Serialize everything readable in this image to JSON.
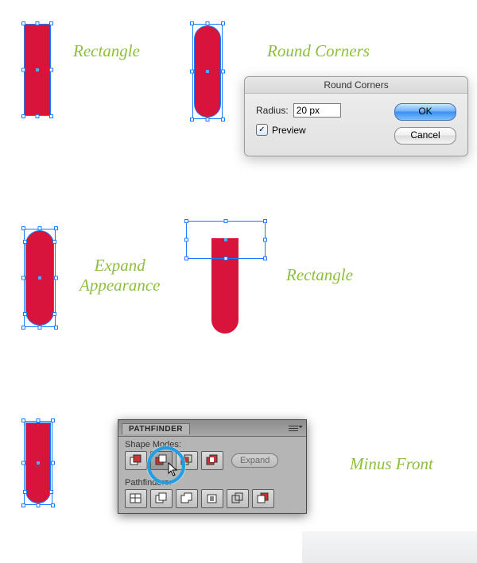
{
  "labels": {
    "rectangle1": "Rectangle",
    "round_corners": "Round Corners",
    "expand_appearance_l1": "Expand",
    "expand_appearance_l2": "Appearance",
    "rectangle2": "Rectangle",
    "minus_front": "Minus Front"
  },
  "dialog": {
    "title": "Round Corners",
    "radius_label": "Radius:",
    "radius_value": "20 px",
    "preview_label": "Preview",
    "preview_checked": true,
    "ok": "OK",
    "cancel": "Cancel"
  },
  "panel": {
    "tab": "PATHFINDER",
    "shape_modes_label": "Shape Modes:",
    "expand_label": "Expand",
    "pathfinders_label": "Pathfinders:",
    "shape_buttons": [
      "unite",
      "minus-front",
      "intersect",
      "exclude"
    ],
    "pathfinder_buttons": [
      "divide",
      "trim",
      "merge",
      "crop",
      "outline",
      "minus-back"
    ]
  },
  "colors": {
    "red": "#d9143a",
    "label_green": "#8dbf3d",
    "highlight_blue": "#1fa0e6"
  }
}
